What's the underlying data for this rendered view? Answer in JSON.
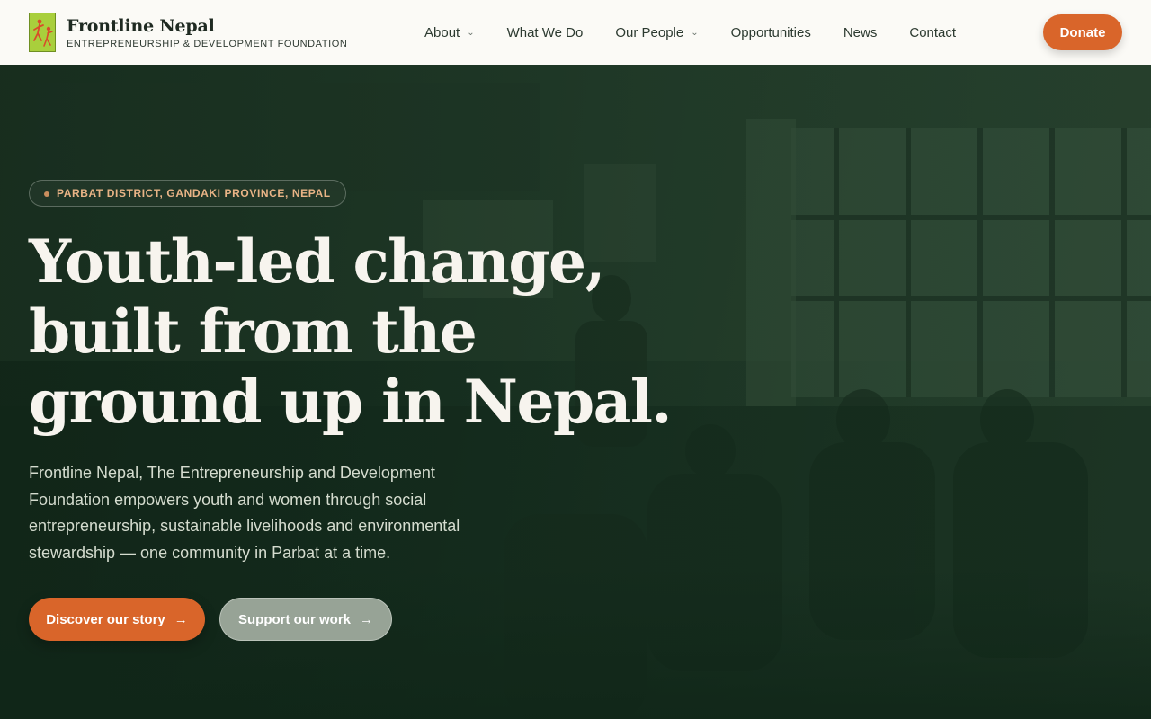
{
  "brand": {
    "name": "Frontline Nepal",
    "tagline": "ENTREPRENEURSHIP & DEVELOPMENT FOUNDATION",
    "logo_icon": "frontline-nepal-logo",
    "logo_color": "#a9cf3c"
  },
  "nav": {
    "items": [
      {
        "label": "About",
        "has_dropdown": true
      },
      {
        "label": "What We Do",
        "has_dropdown": false
      },
      {
        "label": "Our People",
        "has_dropdown": true
      },
      {
        "label": "Opportunities",
        "has_dropdown": false
      },
      {
        "label": "News",
        "has_dropdown": false
      },
      {
        "label": "Contact",
        "has_dropdown": false
      }
    ],
    "donate_label": "Donate"
  },
  "hero": {
    "location_badge": "PARBAT DISTRICT, GANDAKI PROVINCE, NEPAL",
    "headline_lines": [
      "Youth-led change,",
      "built from the",
      "ground up in Nepal."
    ],
    "lead": "Frontline Nepal, The Entrepreneurship and Development Foundation empowers youth and women through social entrepreneurship, sustainable livelihoods and environmental stewardship — one community in Parbat at a time.",
    "primary_cta": "Discover our story",
    "secondary_cta": "Support our work",
    "arrow_icon": "arrow-right-icon"
  },
  "colors": {
    "accent": "#d9652a",
    "hero_green": "#1b3322",
    "badge_text": "#e9b486"
  }
}
